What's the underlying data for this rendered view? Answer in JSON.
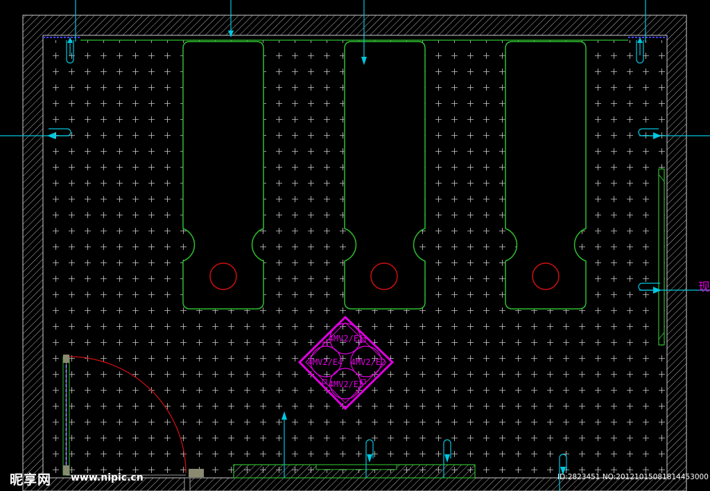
{
  "drawing": {
    "fixture_labels": [
      "4MV2/E1",
      "4MV2/E4",
      "4MV2/E2",
      "4MV2/E3"
    ],
    "edge_label": "现"
  },
  "watermark": {
    "logo": "昵享网",
    "url": "www.nipic.cn",
    "id": "ID:2823451 NO:20121015081814453000"
  },
  "colors": {
    "wall_hatch": "#b8b8b8",
    "grid_cross": "#cfcfcf",
    "bed_outline": "#2fbf2f",
    "fixture": "#e000e0",
    "annotation": "#00c8e0",
    "door": "#cc1010"
  }
}
